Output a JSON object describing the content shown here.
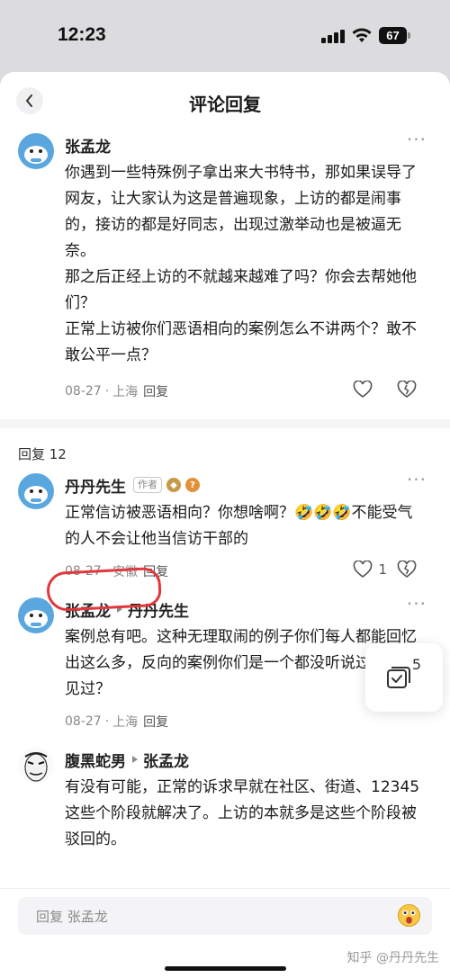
{
  "status": {
    "time": "12:23",
    "battery": "67"
  },
  "nav": {
    "title": "评论回复"
  },
  "main_comment": {
    "author": "张孟龙",
    "paragraphs": [
      "你遇到一些特殊例子拿出来大书特书，那如果误导了网友，让大家认为这是普遍现象，上访的都是闹事的，接访的都是好同志，出现过激举动也是被逼无奈。",
      "那之后正经上访的不就越来越难了吗？你会去帮她他们？",
      "正常上访被你们恶语相向的案例怎么不讲两个？敢不敢公平一点？"
    ],
    "date": "08-27",
    "location": "上海",
    "reply_label": "回复"
  },
  "replies_header": {
    "label": "回复 12"
  },
  "replies": [
    {
      "author": "丹丹先生",
      "tag": "作者",
      "text": "正常信访被恶语相向？你想啥啊？🤣🤣🤣不能受气的人不会让他当信访干部的",
      "date": "08-27",
      "location": "安徽",
      "reply_label": "回复",
      "likes": "1"
    },
    {
      "author": "张孟龙",
      "reply_to": "丹丹先生",
      "text": "案例总有吧。这种无理取闹的例子你们每人都能回忆出这么多，反向的案例你们是一个都没听说过，没遇见过？",
      "date": "08-27",
      "location": "上海",
      "reply_label": "回复"
    },
    {
      "author": "腹黑蛇男",
      "reply_to": "张孟龙",
      "text": "有没有可能，正常的诉求早就在社区、街道、12345这些个阶段就解决了。上访的本就多是这些个阶段被驳回的。"
    }
  ],
  "floating": {
    "count": "5"
  },
  "bottom": {
    "placeholder": "回复 张孟龙",
    "watermark": "知乎 @丹丹先生"
  },
  "colors": {
    "highlight": "#e0383c",
    "avatar_blue": "#5aa7e0"
  }
}
